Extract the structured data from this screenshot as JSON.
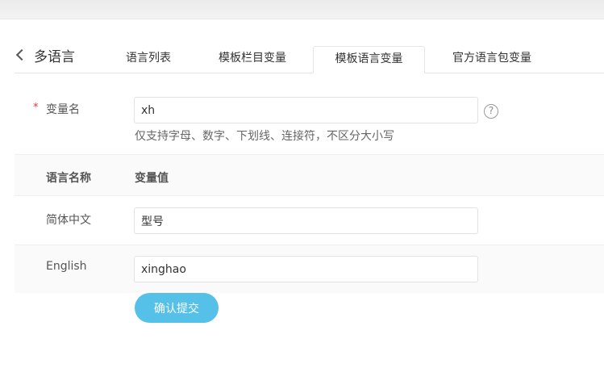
{
  "header": {
    "back_label": "多语言",
    "tabs": [
      {
        "label": "语言列表"
      },
      {
        "label": "模板栏目变量"
      },
      {
        "label": "模板语言变量",
        "active": true
      },
      {
        "label": "官方语言包变量"
      }
    ]
  },
  "form": {
    "required_mark": "*",
    "var_name_label": "变量名",
    "var_name_value": "xh",
    "help_glyph": "?",
    "hint": "仅支持字母、数字、下划线、连接符，不区分大小写",
    "table": {
      "col_lang": "语言名称",
      "col_value": "变量值",
      "rows": [
        {
          "lang": "简体中文",
          "value": "型号"
        },
        {
          "lang": "English",
          "value": "xinghao"
        }
      ]
    },
    "submit_label": "确认提交"
  },
  "colors": {
    "accent": "#55c1e8",
    "required": "#e4393c"
  }
}
